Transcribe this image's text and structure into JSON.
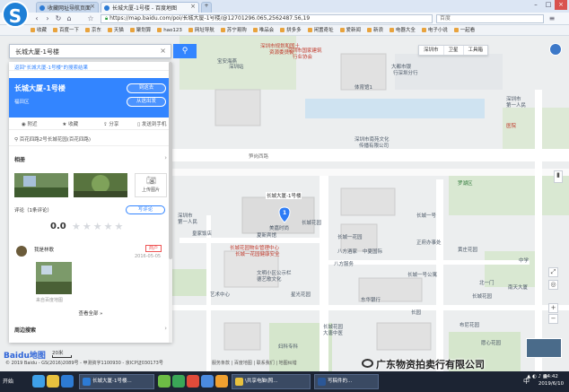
{
  "browser": {
    "tabs": [
      {
        "label": "收藏网址导航页面"
      },
      {
        "label": "长城大厦-1号楼 - 百度地图"
      }
    ],
    "url": "https://map.baidu.com/poi/长城大厦-1号楼/@12701296.065,2562487.56,19",
    "search_engine_placeholder": "百度",
    "bookmarks": [
      "收藏",
      "百度一下",
      "京东",
      "天猫",
      "聚划算",
      "hao123",
      "网址导航",
      "苏宁易购",
      "唯品会",
      "拼多多",
      "闲置奇址",
      "爱新闻",
      "新浪",
      "电器大全",
      "电子小说",
      "一起看"
    ]
  },
  "map": {
    "search_value": "长城大厦-1号楼",
    "toolbar": {
      "city": "深圳市",
      "satellite": "卫星",
      "tools": "工具箱"
    },
    "labels": [
      {
        "text": "宝安海燕"
      },
      {
        "text": "深圳市规划和国土"
      },
      {
        "text": "资源委员会"
      },
      {
        "text": "深圳市国家建筑"
      },
      {
        "text": "行业协会"
      },
      {
        "text": "深圳站"
      },
      {
        "text": "大都市银"
      },
      {
        "text": "行深圳分行"
      },
      {
        "text": "体育馆1"
      },
      {
        "text": "深圳市"
      },
      {
        "text": "第一人民"
      },
      {
        "text": "医院"
      },
      {
        "text": "深圳市南苑文化"
      },
      {
        "text": "传播有限公司"
      },
      {
        "text": "笋岗西路"
      },
      {
        "text": "长城大厦-1号楼"
      },
      {
        "text": "长城花园"
      },
      {
        "text": "长城一号"
      },
      {
        "text": "长城一花园"
      },
      {
        "text": "八方酒家"
      },
      {
        "text": "八方服务"
      },
      {
        "text": "正府办事处"
      },
      {
        "text": "长城一号公寓"
      },
      {
        "text": "长城花园物业管理中心"
      },
      {
        "text": "长城一花园健康安全"
      },
      {
        "text": "文明小区公示栏"
      },
      {
        "text": "德艺歌文化"
      },
      {
        "text": "艺术中心"
      },
      {
        "text": "星光花园"
      },
      {
        "text": "长城花园"
      },
      {
        "text": "大唐中医"
      },
      {
        "text": "妇科专科"
      },
      {
        "text": "东华银行"
      },
      {
        "text": "长园"
      },
      {
        "text": "黄庄花园"
      },
      {
        "text": "北一门"
      },
      {
        "text": "南天大厦"
      },
      {
        "text": "中学"
      },
      {
        "text": "布尼花园"
      },
      {
        "text": "长城花园"
      },
      {
        "text": "中夏国际"
      },
      {
        "text": "美嘉时尚"
      },
      {
        "text": "夏新宾馆"
      },
      {
        "text": "愿心花园"
      },
      {
        "text": "皇家饭店"
      },
      {
        "text": "罗湖区"
      },
      {
        "text": "深圳市"
      },
      {
        "text": "第一人民"
      }
    ],
    "pin_number": "1"
  },
  "panel": {
    "breadcrumb": "返回\"长城大厦-1号楼\"的搜索结果",
    "place_name": "长城大厦-1号楼",
    "district": "福田区",
    "route_to": "到这去",
    "route_from": "从这出发",
    "actions": [
      "附近",
      "收藏",
      "分享",
      "发送到手机"
    ],
    "address": "百花四路2号长城花园(百花四路)",
    "photos_title": "相册",
    "upload_label": "上传图片",
    "review_head": "评论（1条评论）",
    "write_review": "写评论",
    "score": "0.0",
    "stars": "★★★★★",
    "reviewer": "我是林歌",
    "review_tag": "商户",
    "review_date": "2016-05-05",
    "review_source": "来自百度地图",
    "view_all": "查看全部 »",
    "nearby": "周边搜索"
  },
  "footer": {
    "logo": "Baidu地图",
    "scale": "20米",
    "copyright": "© 2019 Baidu - GS(2016)2089号 - 甲测资字1100930 - 京ICP证030173号",
    "links": "服务条款 | 百度地图 | 联系我们 | 地图纠错",
    "watermark": "广东物资拍卖行有限公司"
  },
  "taskbar": {
    "start": "开始",
    "tasks": [
      "长城大厦-1号楼...",
      "\\共享电脑\\照...",
      "写稿件的..."
    ],
    "time": "14:42",
    "date": "2019/6/10",
    "ime": "中"
  },
  "colors": {
    "accent": "#3385ff",
    "road": "#ffffff",
    "green_area": "#cfe8c6",
    "water": "#a9d3ec"
  }
}
